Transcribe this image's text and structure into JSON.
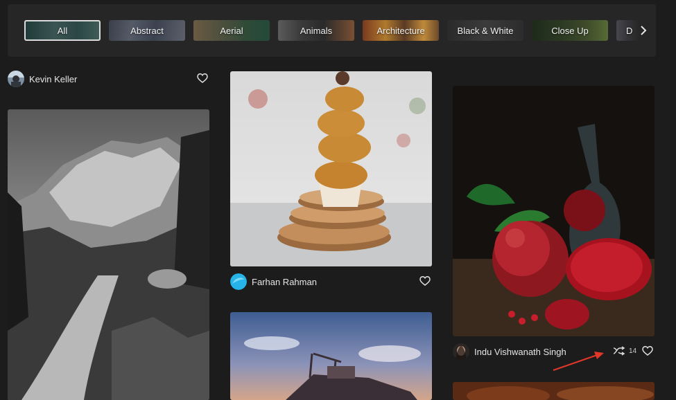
{
  "filters": {
    "chips": [
      {
        "label": "All",
        "active": true
      },
      {
        "label": "Abstract",
        "active": false
      },
      {
        "label": "Aerial",
        "active": false
      },
      {
        "label": "Animals",
        "active": false
      },
      {
        "label": "Architecture",
        "active": false
      },
      {
        "label": "Black & White",
        "active": false
      },
      {
        "label": "Close Up",
        "active": false
      },
      {
        "label": "D",
        "active": false
      }
    ],
    "next_icon": "chevron-right-icon"
  },
  "posts": {
    "col1": {
      "author": "Kevin Keller",
      "icon": "heart-icon"
    },
    "col2": {
      "author": "Farhan Rahman",
      "icon": "heart-icon"
    },
    "col3": {
      "author": "Indu Vishwanath Singh",
      "share_count": "14",
      "icon": "heart-icon"
    }
  },
  "annotation": {
    "arrow_color": "#e0372a"
  }
}
